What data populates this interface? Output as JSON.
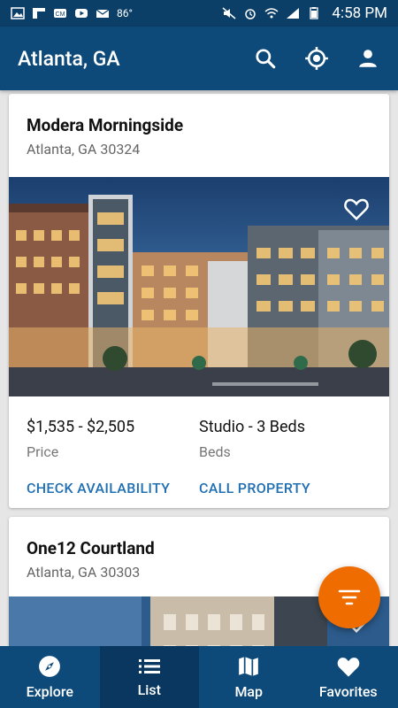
{
  "statusbar": {
    "temperature": "86°",
    "time": "4:58 PM"
  },
  "header": {
    "title": "Atlanta, GA"
  },
  "listings": [
    {
      "name": "Modera Morningside",
      "address": "Atlanta, GA 30324",
      "price_value": "$1,535 - $2,505",
      "price_label": "Price",
      "beds_value": "Studio - 3 Beds",
      "beds_label": "Beds",
      "action_primary": "CHECK AVAILABILITY",
      "action_secondary": "CALL PROPERTY"
    },
    {
      "name": "One12 Courtland",
      "address": "Atlanta, GA 30303"
    }
  ],
  "bottom_nav": [
    {
      "label": "Explore",
      "icon": "compass-icon"
    },
    {
      "label": "List",
      "icon": "list-icon",
      "active": true
    },
    {
      "label": "Map",
      "icon": "map-icon"
    },
    {
      "label": "Favorites",
      "icon": "heart-icon"
    }
  ],
  "colors": {
    "header_bg": "#0e4a79",
    "statusbar_bg": "#0c3f68",
    "link": "#1f6fb2",
    "fab": "#ef6c00"
  }
}
